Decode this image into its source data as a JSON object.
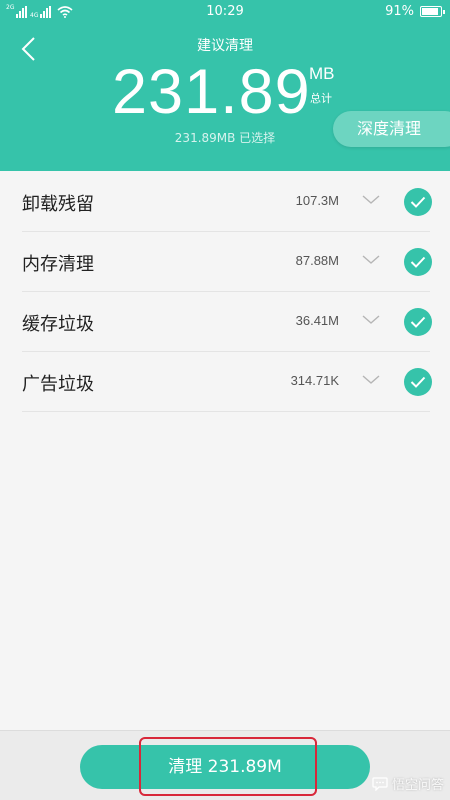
{
  "status_bar": {
    "net1": "2G",
    "net2": "4G",
    "time": "10:29",
    "battery": "91%",
    "battery_level": 0.91
  },
  "header": {
    "title": "建议清理",
    "total_value": "231.89",
    "total_unit": "MB",
    "total_sub": "总计",
    "selected_text": "231.89MB 已选择",
    "deep_clean_label": "深度清理",
    "accent_color": "#36c3aa"
  },
  "items": [
    {
      "label": "卸载残留",
      "size": "107.3M",
      "checked": true
    },
    {
      "label": "内存清理",
      "size": "87.88M",
      "checked": true
    },
    {
      "label": "缓存垃圾",
      "size": "36.41M",
      "checked": true
    },
    {
      "label": "广告垃圾",
      "size": "314.71K",
      "checked": true
    }
  ],
  "footer": {
    "clean_label": "清理 231.89M",
    "watermark": "悟空问答"
  }
}
